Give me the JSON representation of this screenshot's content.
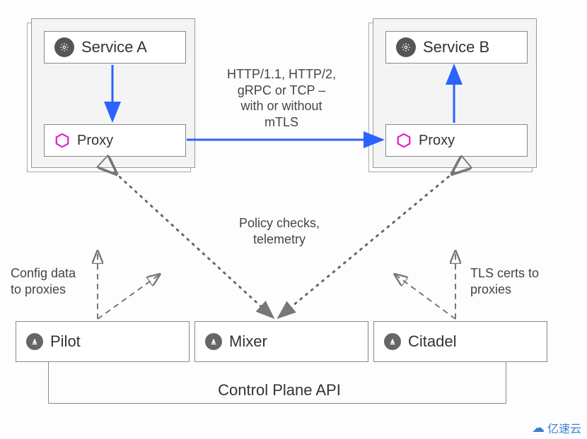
{
  "pods": {
    "a": {
      "service": "Service A",
      "proxy": "Proxy"
    },
    "b": {
      "service": "Service B",
      "proxy": "Proxy"
    }
  },
  "traffic_label": "HTTP/1.1, HTTP/2,\ngRPC or TCP –\nwith or without\nmTLS",
  "policy_label": "Policy checks,\ntelemetry",
  "config_label": "Config data\nto proxies",
  "tls_label": "TLS certs to\nproxies",
  "control_plane": {
    "pilot": "Pilot",
    "mixer": "Mixer",
    "citadel": "Citadel",
    "api_label": "Control Plane API"
  },
  "watermark": "亿速云",
  "colors": {
    "blue": "#2b63ff",
    "magenta": "#e01fd0",
    "gray": "#777"
  }
}
